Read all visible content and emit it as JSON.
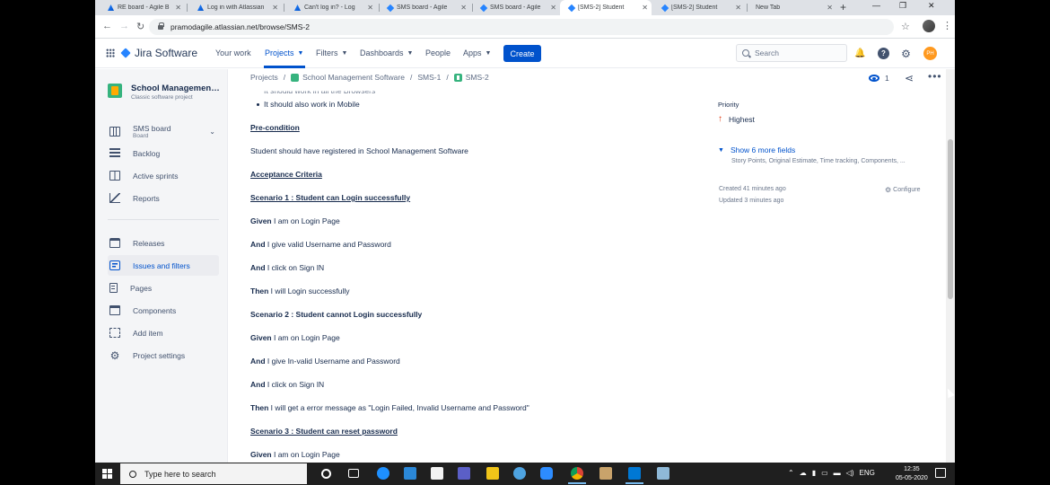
{
  "browser": {
    "tabs": [
      {
        "title": "RE board - Agile B",
        "icon": "atlassian-icon",
        "active": false
      },
      {
        "title": "Log in with Atlassian",
        "icon": "atlassian-icon",
        "active": false
      },
      {
        "title": "Can't log in? - Log",
        "icon": "atlassian-icon",
        "active": false
      },
      {
        "title": "SMS board - Agile",
        "icon": "jira-icon",
        "active": false
      },
      {
        "title": "SMS board - Agile",
        "icon": "jira-icon",
        "active": false
      },
      {
        "title": "[SMS-2] Student",
        "icon": "jira-icon",
        "active": true
      },
      {
        "title": "[SMS-2] Student",
        "icon": "jira-icon",
        "active": false
      },
      {
        "title": "New Tab",
        "icon": "",
        "active": false
      }
    ],
    "url": "pramodagile.atlassian.net/browse/SMS-2"
  },
  "jira_nav": {
    "product": "Jira Software",
    "items": [
      {
        "label": "Your work",
        "has_chevron": false
      },
      {
        "label": "Projects",
        "has_chevron": true
      },
      {
        "label": "Filters",
        "has_chevron": true
      },
      {
        "label": "Dashboards",
        "has_chevron": true
      },
      {
        "label": "People",
        "has_chevron": false
      },
      {
        "label": "Apps",
        "has_chevron": true
      }
    ],
    "create_label": "Create",
    "search_placeholder": "Search",
    "avatar_initials": "PH"
  },
  "sidebar": {
    "project_name": "School Management...",
    "project_type": "Classic software project",
    "board_name": "SMS board",
    "board_sub": "Board",
    "items": [
      {
        "label": "Backlog",
        "icon": "backlog-icon"
      },
      {
        "label": "Active sprints",
        "icon": "sprint-icon"
      },
      {
        "label": "Reports",
        "icon": "reports-icon"
      },
      {
        "label": "Releases",
        "icon": "releases-icon"
      },
      {
        "label": "Issues and filters",
        "icon": "filter-icon"
      },
      {
        "label": "Pages",
        "icon": "pages-icon"
      },
      {
        "label": "Components",
        "icon": "components-icon"
      },
      {
        "label": "Add item",
        "icon": "add-item-icon"
      },
      {
        "label": "Project settings",
        "icon": "gear-icon"
      }
    ]
  },
  "breadcrumb": [
    "Projects",
    "School Management Software",
    "SMS-1",
    "SMS-2"
  ],
  "description": {
    "cut_line": "It should work in all the Browsers",
    "bullet": "It should also work in Mobile",
    "precondition_heading": "Pre-condition",
    "precondition_text": "Student should have registered in School Management Software",
    "acceptance_heading": "Acceptance Criteria",
    "scenario1": "Scenario 1 : Student can Login successfully",
    "s1_lines": [
      {
        "kw": "Given",
        "text": " I am on Login Page"
      },
      {
        "kw": "And",
        "text": " I give valid Username and Password"
      },
      {
        "kw": "And",
        "text": " I click on Sign IN"
      },
      {
        "kw": "Then",
        "text": " I will Login successfully"
      }
    ],
    "scenario2": "Scenario 2 : Student cannot Login successfully",
    "s2_lines": [
      {
        "kw": "Given",
        "text": " I am on Login Page"
      },
      {
        "kw": "And",
        "text": " I give In-valid Username and Password"
      },
      {
        "kw": "And",
        "text": " I click on Sign IN"
      },
      {
        "kw": "Then",
        "text": " I will get a error message as \"Login Failed, Invalid Username and Password\""
      }
    ],
    "scenario3": "Scenario 3 : Student can reset password",
    "s3_lines": [
      {
        "kw": "Given",
        "text": " I am on Login Page"
      }
    ]
  },
  "details": {
    "watch_count": "1",
    "priority_label": "Priority",
    "priority_value": "Highest",
    "show_more": "Show 6 more fields",
    "show_more_sub": "Story Points, Original Estimate, Time tracking, Components, ...",
    "created": "Created 41 minutes ago",
    "updated": "Updated 3 minutes ago",
    "configure": "Configure"
  },
  "taskbar": {
    "search_placeholder": "Type here to search",
    "lang": "ENG",
    "time": "12:35",
    "date": "05-05-2020"
  },
  "colors": {
    "brand_blue": "#0052cc",
    "priority_red": "#de350b"
  }
}
